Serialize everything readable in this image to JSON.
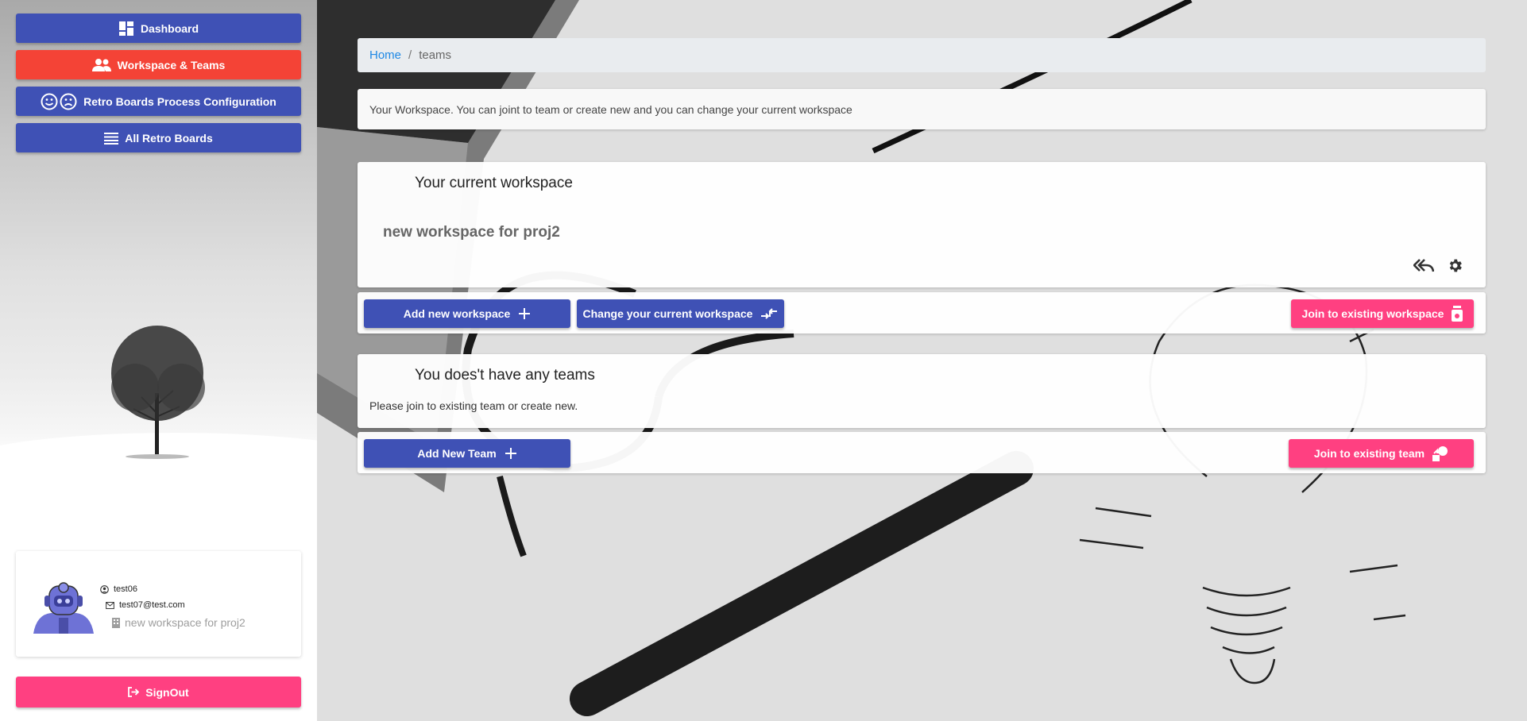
{
  "sidebar": {
    "nav": [
      {
        "label": "Dashboard",
        "icon": "dashboard-icon"
      },
      {
        "label": "Workspace & Teams",
        "icon": "people-icon"
      },
      {
        "label": "Retro Boards Process Configuration",
        "icon": "smile-frown-icon"
      },
      {
        "label": "All Retro Boards",
        "icon": "list-icon"
      }
    ],
    "profile": {
      "username": "test06",
      "email": "test07@test.com",
      "workspace": "new workspace for proj2"
    },
    "signout_label": "SignOut"
  },
  "breadcrumb": {
    "home": "Home",
    "separator": "/",
    "current": "teams"
  },
  "info_text": "Your Workspace. You can joint to team or create new and you can change your current workspace",
  "workspace": {
    "title": "Your current workspace",
    "name": "new workspace for proj2",
    "leave_icon": "reply-all-icon",
    "settings_icon": "gear-icon"
  },
  "workspace_actions": {
    "add": "Add new workspace",
    "change": "Change your current workspace",
    "join": "Join to existing workspace"
  },
  "teams": {
    "title": "You does't have any teams",
    "message": "Please join to existing team or create new."
  },
  "team_actions": {
    "add": "Add New Team",
    "join": "Join to existing team"
  },
  "colors": {
    "primary": "#3f51b5",
    "active": "#f44336",
    "accent": "#ff4081",
    "link": "#1e88e5"
  }
}
